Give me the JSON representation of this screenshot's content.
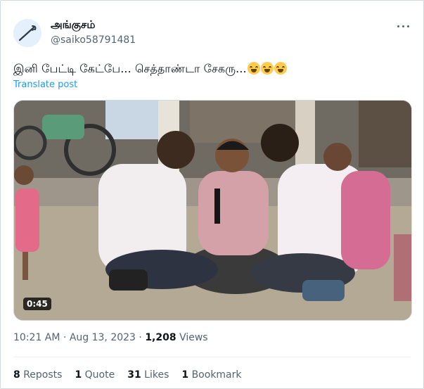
{
  "author": {
    "display_name": "அங்குசம்",
    "handle": "@saiko58791481"
  },
  "tweet": {
    "text": "இனி பேட்டி கேட்பே... செத்தாண்டா சேகரு...",
    "emoji_icon": "face-with-tears-of-joy-icon",
    "emoji_count": 3,
    "translate_label": "Translate post"
  },
  "media": {
    "duration": "0:45"
  },
  "meta": {
    "time": "10:21 AM",
    "separator": "·",
    "date": "Aug 13, 2023",
    "views_count": "1,208",
    "views_label": "Views"
  },
  "stats": {
    "reposts_count": "8",
    "reposts_label": "Reposts",
    "quotes_count": "1",
    "quotes_label": "Quote",
    "likes_count": "31",
    "likes_label": "Likes",
    "bookmarks_count": "1",
    "bookmarks_label": "Bookmark"
  },
  "colors": {
    "link": "#1d9bf0",
    "secondary_text": "#536471",
    "primary_text": "#0f1419"
  }
}
